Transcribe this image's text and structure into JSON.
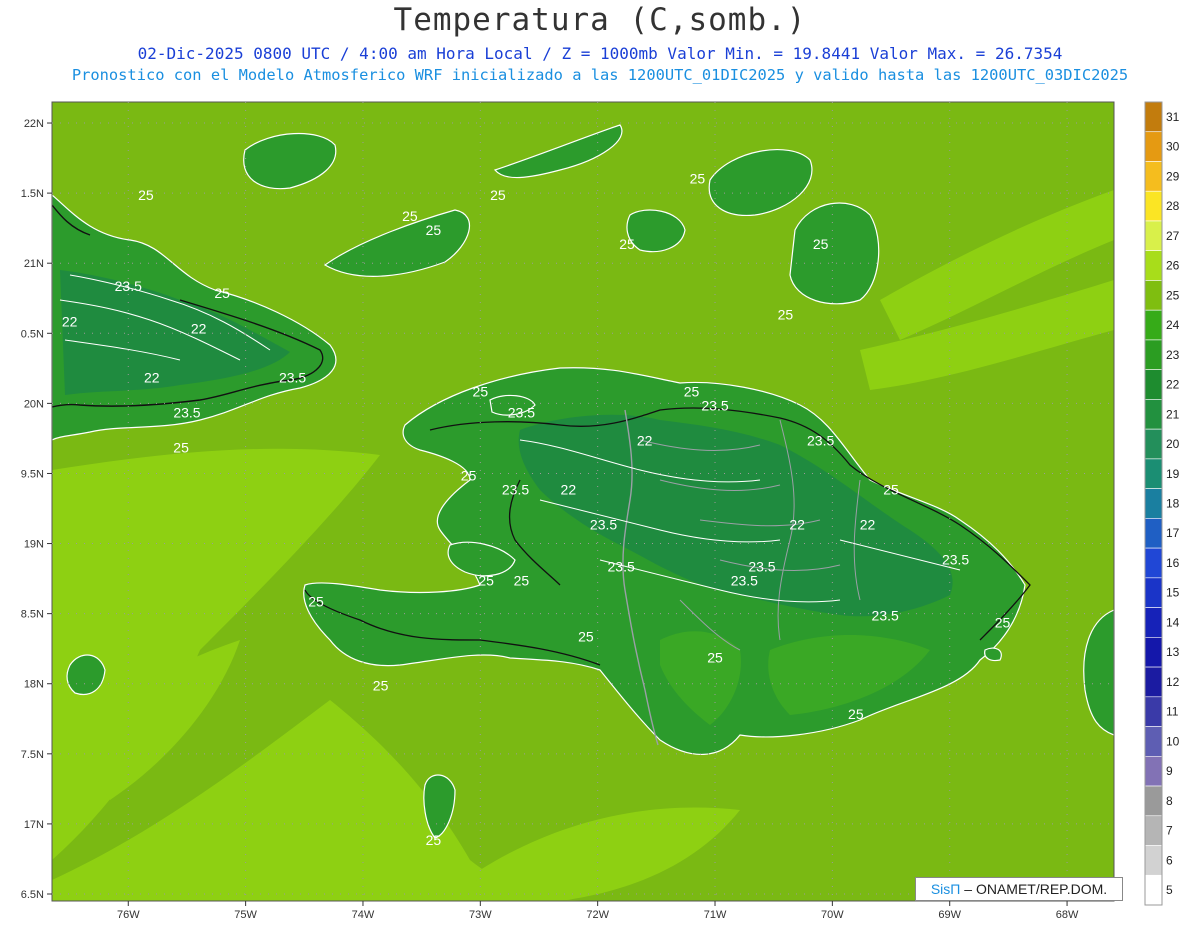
{
  "header": {
    "title": "Temperatura (C,somb.)",
    "line1": "02-Dic-2025  0800 UTC / 4:00 am Hora Local / Z = 1000mb   Valor Min. = 19.8441  Valor Max. = 26.7354",
    "line2": "Pronostico con el Modelo Atmosferico WRF inicializado a las 1200UTC_01DIC2025 y valido hasta las  1200UTC_03DIC2025"
  },
  "map": {
    "lat_labels": [
      "22N",
      "1.5N",
      "21N",
      "0.5N",
      "20N",
      "9.5N",
      "19N",
      "8.5N",
      "18N",
      "7.5N",
      "17N",
      "6.5N"
    ],
    "lon_labels": [
      "76W",
      "75W",
      "74W",
      "73W",
      "72W",
      "71W",
      "70W",
      "69W",
      "68W"
    ],
    "contour_labels": [
      {
        "text": "25",
        "lon": -75.85,
        "lat": 21.45
      },
      {
        "text": "25",
        "lon": -73.6,
        "lat": 21.3
      },
      {
        "text": "25",
        "lon": -73.4,
        "lat": 21.2
      },
      {
        "text": "25",
        "lon": -72.85,
        "lat": 21.45
      },
      {
        "text": "25",
        "lon": -71.15,
        "lat": 21.57
      },
      {
        "text": "25",
        "lon": -71.75,
        "lat": 21.1
      },
      {
        "text": "25",
        "lon": -70.1,
        "lat": 21.1
      },
      {
        "text": "25",
        "lon": -70.4,
        "lat": 20.6
      },
      {
        "text": "23.5",
        "lon": -76.0,
        "lat": 20.8
      },
      {
        "text": "25",
        "lon": -75.2,
        "lat": 20.75
      },
      {
        "text": "22",
        "lon": -76.5,
        "lat": 20.55
      },
      {
        "text": "22",
        "lon": -75.4,
        "lat": 20.5
      },
      {
        "text": "22",
        "lon": -75.8,
        "lat": 20.15
      },
      {
        "text": "23.5",
        "lon": -74.6,
        "lat": 20.15
      },
      {
        "text": "23.5",
        "lon": -75.5,
        "lat": 19.9
      },
      {
        "text": "25",
        "lon": -75.55,
        "lat": 19.65
      },
      {
        "text": "25",
        "lon": -73.0,
        "lat": 20.05
      },
      {
        "text": "23.5",
        "lon": -72.65,
        "lat": 19.9
      },
      {
        "text": "25",
        "lon": -71.2,
        "lat": 20.05
      },
      {
        "text": "23.5",
        "lon": -71.0,
        "lat": 19.95
      },
      {
        "text": "22",
        "lon": -71.6,
        "lat": 19.7
      },
      {
        "text": "23.5",
        "lon": -70.1,
        "lat": 19.7
      },
      {
        "text": "25",
        "lon": -73.1,
        "lat": 19.45
      },
      {
        "text": "23.5",
        "lon": -72.7,
        "lat": 19.35
      },
      {
        "text": "22",
        "lon": -72.25,
        "lat": 19.35
      },
      {
        "text": "25",
        "lon": -69.5,
        "lat": 19.35
      },
      {
        "text": "23.5",
        "lon": -71.95,
        "lat": 19.1
      },
      {
        "text": "22",
        "lon": -70.3,
        "lat": 19.1
      },
      {
        "text": "22",
        "lon": -69.7,
        "lat": 19.1
      },
      {
        "text": "23.5",
        "lon": -71.8,
        "lat": 18.8
      },
      {
        "text": "23.5",
        "lon": -70.6,
        "lat": 18.8
      },
      {
        "text": "23.5",
        "lon": -70.75,
        "lat": 18.7
      },
      {
        "text": "23.5",
        "lon": -68.95,
        "lat": 18.85
      },
      {
        "text": "25",
        "lon": -72.95,
        "lat": 18.7
      },
      {
        "text": "25",
        "lon": -72.65,
        "lat": 18.7
      },
      {
        "text": "25",
        "lon": -74.4,
        "lat": 18.55
      },
      {
        "text": "23.5",
        "lon": -69.55,
        "lat": 18.45
      },
      {
        "text": "25",
        "lon": -68.55,
        "lat": 18.4
      },
      {
        "text": "25",
        "lon": -72.1,
        "lat": 18.3
      },
      {
        "text": "25",
        "lon": -71.0,
        "lat": 18.15
      },
      {
        "text": "25",
        "lon": -73.85,
        "lat": 17.95
      },
      {
        "text": "25",
        "lon": -69.8,
        "lat": 17.75
      },
      {
        "text": "25",
        "lon": -73.4,
        "lat": 16.85
      }
    ]
  },
  "colorbar": {
    "labels": [
      "31",
      "30",
      "29",
      "28",
      "27",
      "26",
      "25",
      "24",
      "23",
      "22",
      "21",
      "20",
      "19",
      "18",
      "17",
      "16",
      "15",
      "14",
      "13",
      "12",
      "11",
      "10",
      "9",
      "8",
      "7",
      "6",
      "5"
    ],
    "colors": [
      "#c27c0d",
      "#e59a12",
      "#f5bd1e",
      "#fbe524",
      "#d9f04a",
      "#a8dd1a",
      "#7fbe10",
      "#36ab18",
      "#2b9d22",
      "#1e8c2f",
      "#22913f",
      "#238f5b",
      "#1b8e73",
      "#1a7fa0",
      "#1f5fc4",
      "#2047d6",
      "#1a34c8",
      "#1622b8",
      "#1417aa",
      "#1b1ba1",
      "#3a3aa8",
      "#5e5eb3",
      "#8272b5",
      "#9a9a9a",
      "#b5b5b5",
      "#d2d2d2",
      "#ffffff"
    ]
  },
  "footer": {
    "brand": "SisΠ",
    "org": "– ONAMET/REP.DOM."
  },
  "colors": {
    "sea": "#7ab913",
    "sea_warm": "#8ed012",
    "land": "#2c9b2c",
    "land_cool": "#1f8b3f",
    "land_mid": "#3aa825"
  }
}
